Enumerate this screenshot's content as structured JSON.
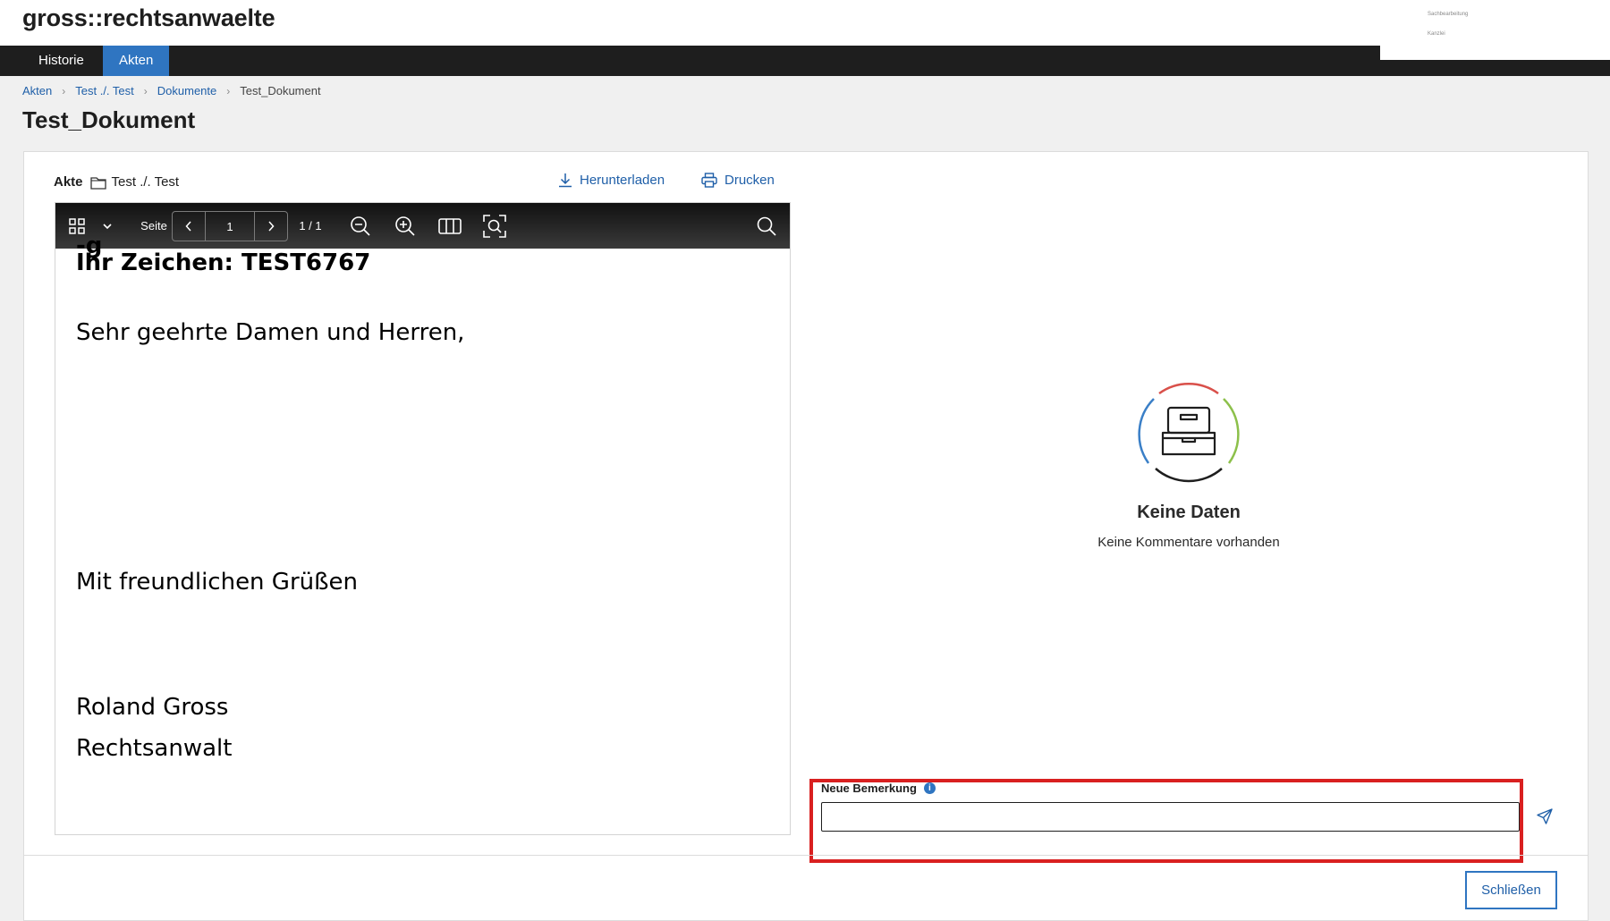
{
  "app": {
    "title": "gross::rechtsanwaelte"
  },
  "user_menu": {
    "items": [
      "Sachbearbeitung",
      "Kanzlei"
    ]
  },
  "nav": {
    "tabs": [
      {
        "label": "Historie",
        "active": false
      },
      {
        "label": "Akten",
        "active": true
      }
    ]
  },
  "breadcrumb": [
    "Akten",
    "Test ./. Test",
    "Dokumente",
    "Test_Dokument"
  ],
  "page": {
    "title": "Test_Dokument"
  },
  "akte": {
    "label": "Akte",
    "value": "Test ./. Test"
  },
  "actions": {
    "download": "Herunterladen",
    "print": "Drucken"
  },
  "viewer": {
    "page_label": "Seite",
    "page_value": "1",
    "page_count": "1 / 1",
    "icons": [
      "thumbnails-icon",
      "chevron-down-icon",
      "prev-page-icon",
      "next-page-icon",
      "zoom-out-icon",
      "zoom-in-icon",
      "two-page-view-icon",
      "fit-page-icon",
      "search-icon"
    ]
  },
  "document": {
    "lines": [
      {
        "text": "Ihr Zeichen: TEST6767",
        "bold": true
      },
      {
        "text": "Sehr geehrte Damen und Herren,",
        "bold": false
      },
      {
        "text": "Mit freundlichen Grüßen",
        "bold": false
      },
      {
        "text": "Roland Gross",
        "bold": false
      },
      {
        "text": "Rechtsanwalt",
        "bold": false
      }
    ]
  },
  "comments": {
    "empty_title": "Keine Daten",
    "empty_subtitle": "Keine Kommentare vorhanden",
    "input_label": "Neue Bemerkung",
    "input_value": "",
    "input_placeholder": ""
  },
  "footer": {
    "close_label": "Schließen"
  },
  "colors": {
    "accent": "#2f75c1",
    "link": "#1f5fa8",
    "highlight": "#d92020",
    "navbar": "#1e1e1e"
  }
}
